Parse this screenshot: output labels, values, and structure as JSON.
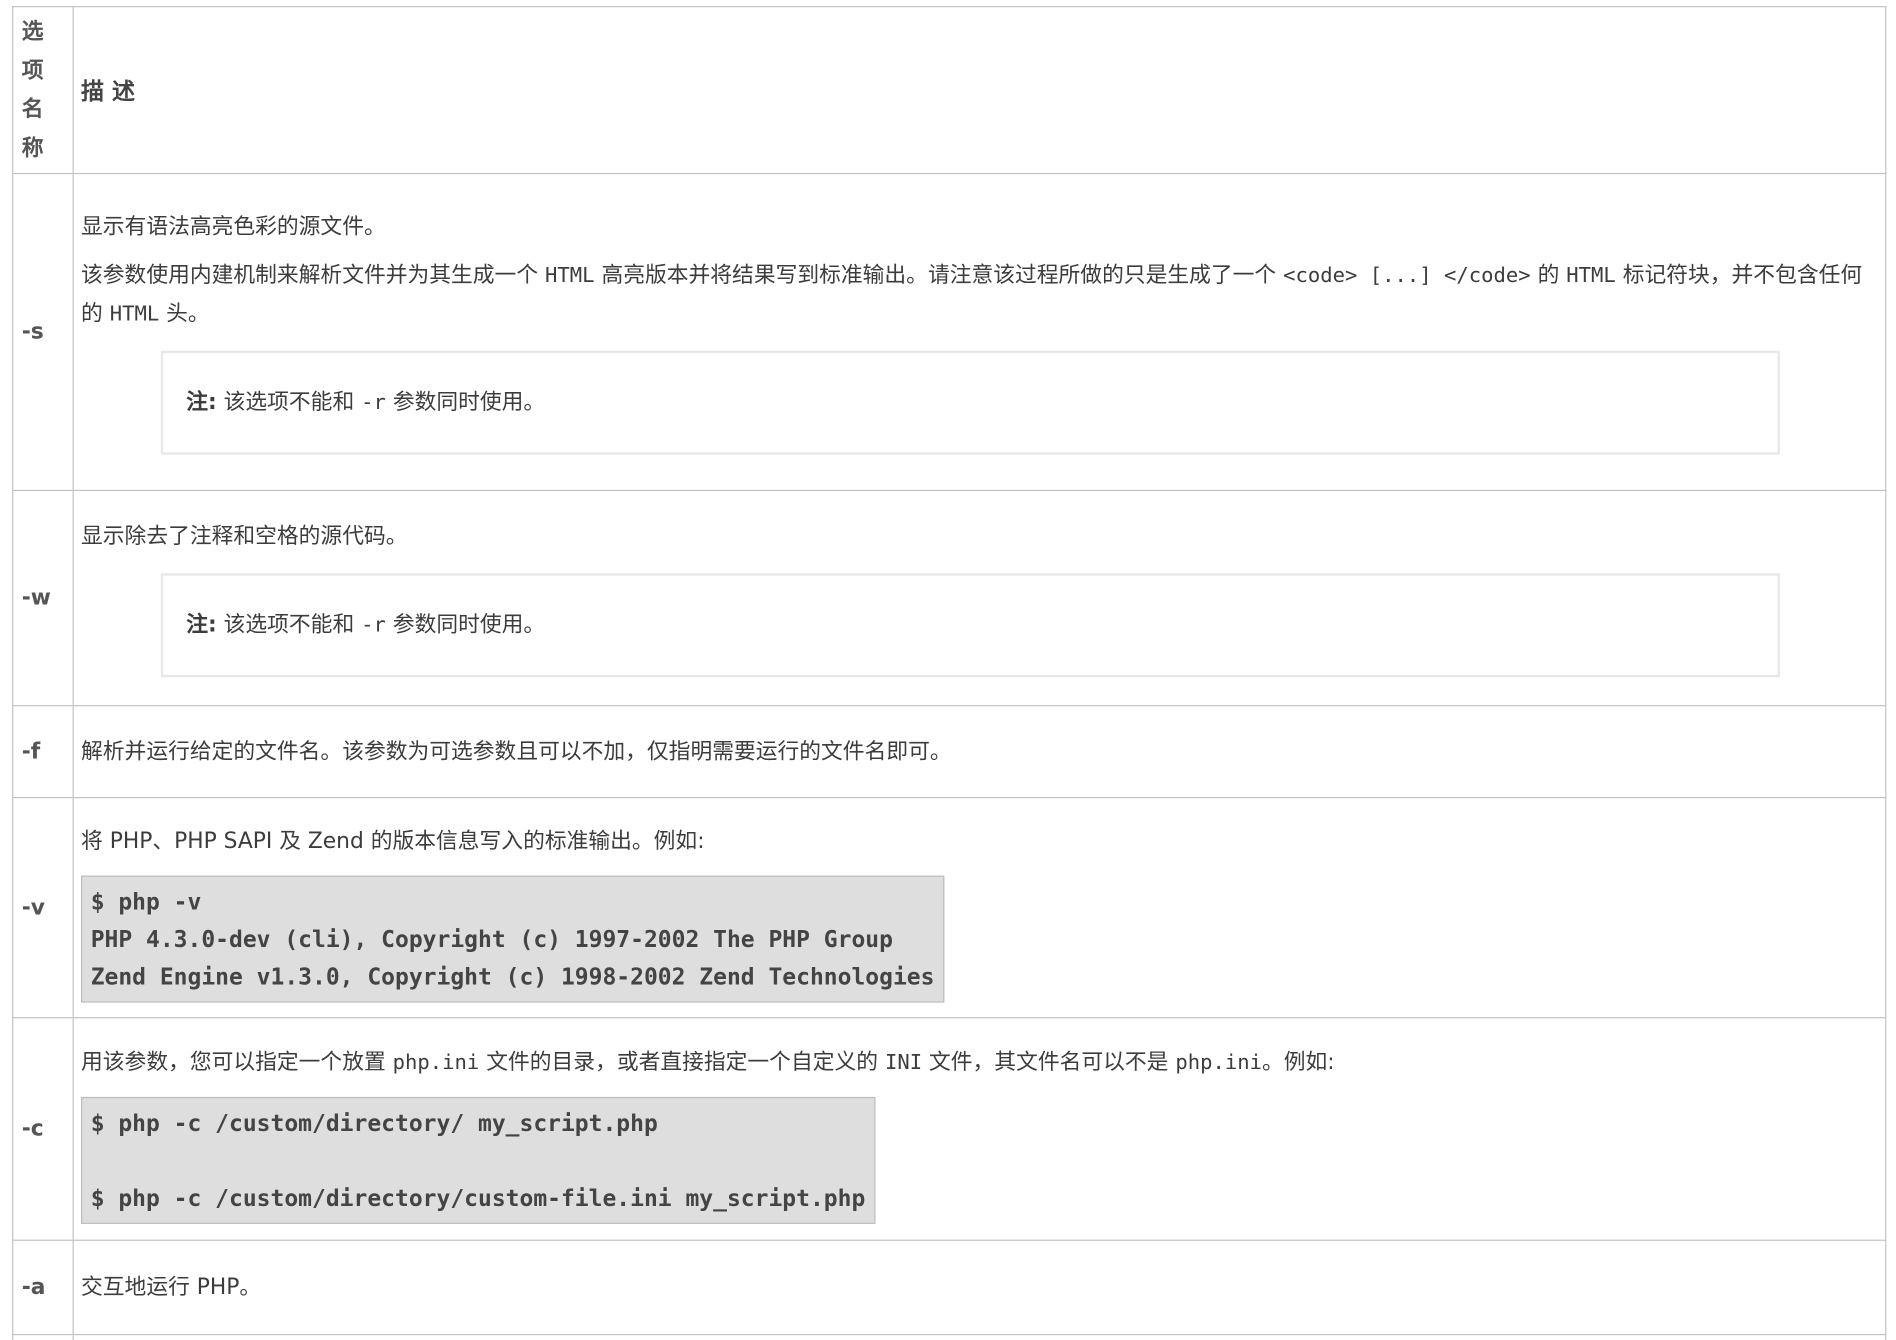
{
  "header": {
    "name_label": "选项名称",
    "desc_label": "描 述"
  },
  "rows": {
    "s": {
      "name": "-s",
      "p1": "显示有语法高亮色彩的源文件。",
      "p2a": "该参数使用内建机制来解析文件并为其生成一个 ",
      "p2b": "HTML",
      "p2c": " 高亮版本并将结果写到标准输出。请注意该过程所做的只是生成了一个 ",
      "p2d": "<code> [...] </code>",
      "p2e": " 的 ",
      "p2f": "HTML",
      "p2g": " 标记符块，并不包含任何的 ",
      "p2h": "HTML",
      "p2i": " 头。",
      "note_label": "注:",
      "note_a": " 该选项不能和 ",
      "note_code": "-r",
      "note_b": " 参数同时使用。"
    },
    "w": {
      "name": "-w",
      "p1": "显示除去了注释和空格的源代码。",
      "note_label": "注:",
      "note_a": " 该选项不能和 ",
      "note_code": "-r",
      "note_b": " 参数同时使用。"
    },
    "f": {
      "name": "-f",
      "p1": "解析并运行给定的文件名。该参数为可选参数且可以不加，仅指明需要运行的文件名即可。"
    },
    "v": {
      "name": "-v",
      "p1": "将 PHP、PHP SAPI 及 Zend 的版本信息写入的标准输出。例如:",
      "code": "$ php -v\nPHP 4.3.0-dev (cli), Copyright (c) 1997-2002 The PHP Group\nZend Engine v1.3.0, Copyright (c) 1998-2002 Zend Technologies"
    },
    "c": {
      "name": "-c",
      "p1a": "用该参数，您可以指定一个放置 ",
      "p1b": "php.ini",
      "p1c": " 文件的目录，或者直接指定一个自定义的 ",
      "p1d": "INI",
      "p1e": " 文件，其文件名可以不是 ",
      "p1f": "php.ini",
      "p1g": "。例如:",
      "code": "$ php -c /custom/directory/ my_script.php\n\n$ php -c /custom/directory/custom-file.ini my_script.php"
    },
    "a": {
      "name": "-a",
      "p1": "交互地运行 PHP。"
    }
  }
}
